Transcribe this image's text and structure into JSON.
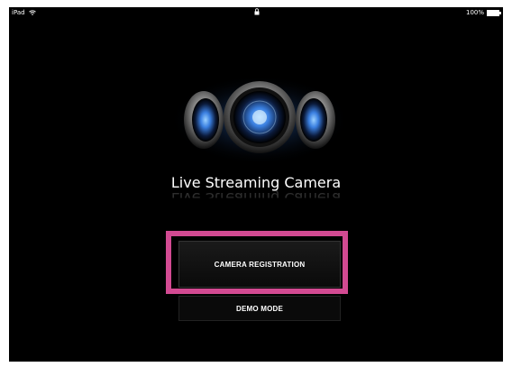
{
  "status_bar": {
    "device": "iPad",
    "battery": "100%",
    "battery_level": 1.0
  },
  "app": {
    "title": "Live Streaming Camera"
  },
  "buttons": {
    "camera_registration": "CAMERA REGISTRATION",
    "demo_mode": "DEMO MODE"
  },
  "colors": {
    "highlight": "#d24a92",
    "background": "#000000",
    "lens_glow": "#5aa0ff"
  }
}
